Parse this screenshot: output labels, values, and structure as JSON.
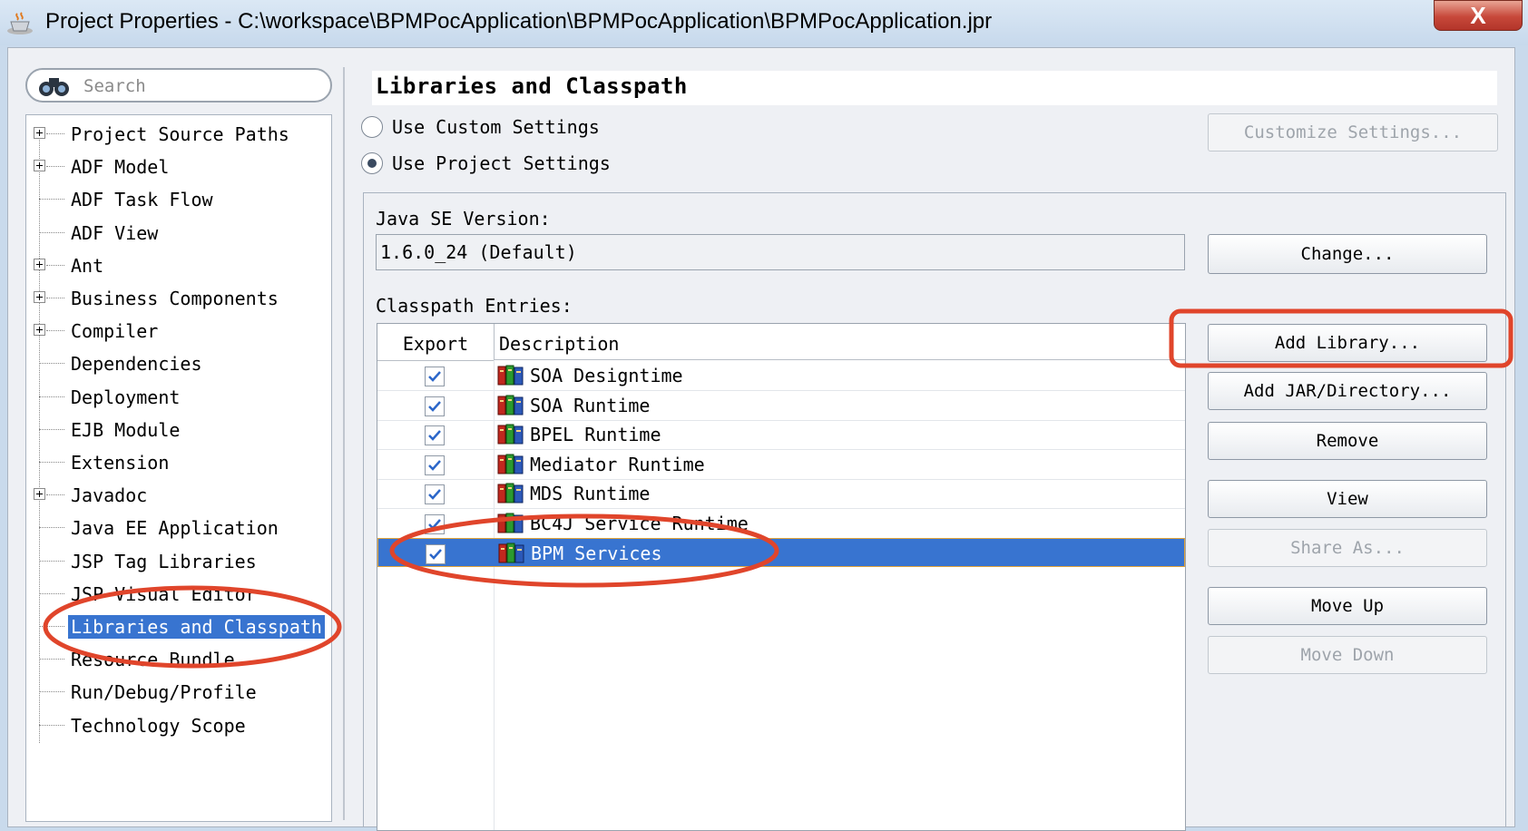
{
  "window": {
    "title": "Project Properties - C:\\workspace\\BPMPocApplication\\BPMPocApplication\\BPMPocApplication.jpr",
    "close_label": "X"
  },
  "search": {
    "placeholder": "Search"
  },
  "tree": {
    "items": [
      {
        "label": "Project Source Paths",
        "expandable": true
      },
      {
        "label": "ADF Model",
        "expandable": true
      },
      {
        "label": "ADF Task Flow",
        "expandable": false
      },
      {
        "label": "ADF View",
        "expandable": false
      },
      {
        "label": "Ant",
        "expandable": true
      },
      {
        "label": "Business Components",
        "expandable": true
      },
      {
        "label": "Compiler",
        "expandable": true
      },
      {
        "label": "Dependencies",
        "expandable": false
      },
      {
        "label": "Deployment",
        "expandable": false
      },
      {
        "label": "EJB Module",
        "expandable": false
      },
      {
        "label": "Extension",
        "expandable": false
      },
      {
        "label": "Javadoc",
        "expandable": true
      },
      {
        "label": "Java EE Application",
        "expandable": false
      },
      {
        "label": "JSP Tag Libraries",
        "expandable": false
      },
      {
        "label": "JSP Visual Editor",
        "expandable": false
      },
      {
        "label": "Libraries and Classpath",
        "expandable": false,
        "selected": true
      },
      {
        "label": "Resource Bundle",
        "expandable": false
      },
      {
        "label": "Run/Debug/Profile",
        "expandable": false
      },
      {
        "label": "Technology Scope",
        "expandable": false
      }
    ]
  },
  "panel": {
    "title": "Libraries and Classpath",
    "use_custom_label": "Use Custom Settings",
    "use_project_label": "Use Project Settings",
    "selected_setting": "project",
    "customize_button": "Customize Settings...",
    "java_se_label": "Java SE Version:",
    "java_se_value": "1.6.0_24 (Default)",
    "change_button": "Change...",
    "classpath_label": "Classpath Entries:"
  },
  "table": {
    "col_export": "Export",
    "col_description": "Description",
    "rows": [
      {
        "label": "SOA Designtime",
        "checked": true
      },
      {
        "label": "SOA Runtime",
        "checked": true
      },
      {
        "label": "BPEL Runtime",
        "checked": true
      },
      {
        "label": "Mediator Runtime",
        "checked": true
      },
      {
        "label": "MDS Runtime",
        "checked": true
      },
      {
        "label": "BC4J Service Runtime",
        "checked": true
      },
      {
        "label": "BPM Services",
        "checked": true,
        "selected": true
      }
    ]
  },
  "buttons": {
    "add_library": "Add Library...",
    "add_jar": "Add JAR/Directory...",
    "remove": "Remove",
    "view": "View",
    "share_as": "Share As...",
    "move_up": "Move Up",
    "move_down": "Move Down"
  },
  "colors": {
    "selection": "#3874d0",
    "annotation": "#e0452b"
  }
}
